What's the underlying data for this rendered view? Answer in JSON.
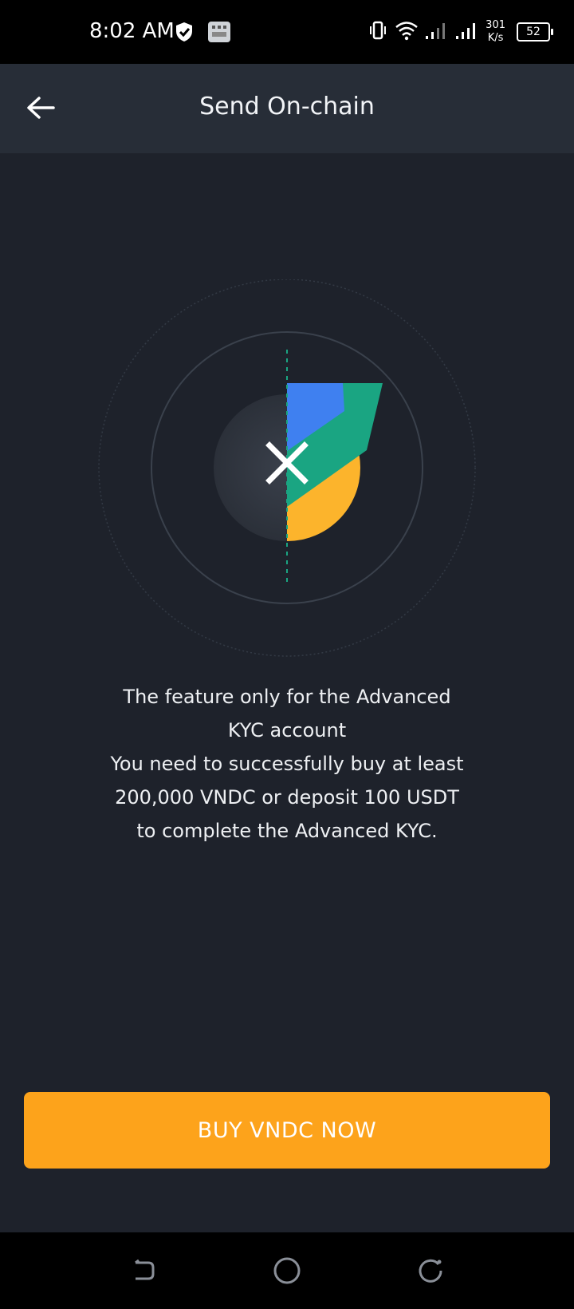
{
  "status_bar": {
    "time": "8:02 AM",
    "net_speed_value": "301",
    "net_speed_unit": "K/s",
    "battery": "52"
  },
  "header": {
    "title": "Send On-chain"
  },
  "message": {
    "line1": "The feature only for the Advanced",
    "line2": "KYC account",
    "line3": "You need to successfully buy at least",
    "line4": "200,000 VNDC or deposit 100 USDT",
    "line5": "to complete the Advanced KYC."
  },
  "actions": {
    "buy_label": "BUY VNDC NOW"
  },
  "colors": {
    "background": "#1e222b",
    "header": "#272d37",
    "accent": "#fda31b",
    "blue": "#3f80f0",
    "green": "#1aa582",
    "yellow": "#fcb42c"
  },
  "icons": {
    "back": "arrow-left-icon",
    "close": "close-icon",
    "nav_back": "back-nav-icon",
    "nav_home": "home-nav-icon",
    "nav_recents": "recents-nav-icon"
  }
}
